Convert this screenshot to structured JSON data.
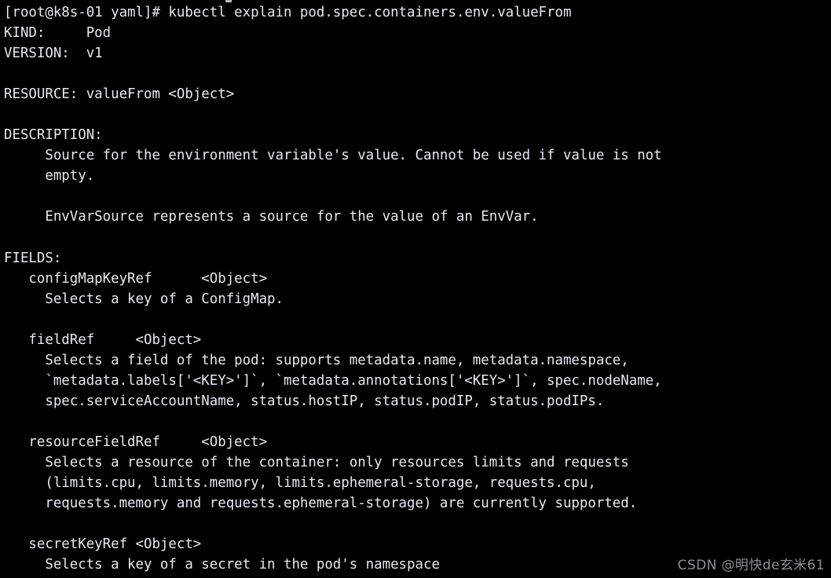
{
  "terminal": {
    "background_color": "#000000",
    "foreground_color": "#e6e9ef",
    "prompt": "[root@k8s-01 yaml]#",
    "command": "kubectl explain pod.spec.containers.env.valueFrom",
    "lines": [
      "[root@k8s-01 yaml]# kubectl explain pod.spec.containers.env.valueFrom",
      "KIND:     Pod",
      "VERSION:  v1",
      "",
      "RESOURCE: valueFrom <Object>",
      "",
      "DESCRIPTION:",
      "     Source for the environment variable's value. Cannot be used if value is not",
      "     empty.",
      "",
      "     EnvVarSource represents a source for the value of an EnvVar.",
      "",
      "FIELDS:",
      "   configMapKeyRef\t<Object>",
      "     Selects a key of a ConfigMap.",
      "",
      "   fieldRef\t<Object>",
      "     Selects a field of the pod: supports metadata.name, metadata.namespace,",
      "     `metadata.labels['<KEY>']`, `metadata.annotations['<KEY>']`, spec.nodeName,",
      "     spec.serviceAccountName, status.hostIP, status.podIP, status.podIPs.",
      "",
      "   resourceFieldRef\t<Object>",
      "     Selects a resource of the container: only resources limits and requests",
      "     (limits.cpu, limits.memory, limits.ephemeral-storage, requests.cpu,",
      "     requests.memory and requests.ephemeral-storage) are currently supported.",
      "",
      "   secretKeyRef <Object>",
      "     Selects a key of a secret in the pod's namespace"
    ],
    "header": {
      "kind_label": "KIND:",
      "kind_value": "Pod",
      "version_label": "VERSION:",
      "version_value": "v1",
      "resource_label": "RESOURCE:",
      "resource_value": "valueFrom <Object>",
      "description_label": "DESCRIPTION:",
      "fields_label": "FIELDS:"
    },
    "description_paragraphs": [
      "Source for the environment variable's value. Cannot be used if value is not empty.",
      "EnvVarSource represents a source for the value of an EnvVar."
    ],
    "fields": [
      {
        "name": "configMapKeyRef",
        "type": "<Object>",
        "description": "Selects a key of a ConfigMap."
      },
      {
        "name": "fieldRef",
        "type": "<Object>",
        "description": "Selects a field of the pod: supports metadata.name, metadata.namespace, `metadata.labels['<KEY>']`, `metadata.annotations['<KEY>']`, spec.nodeName, spec.serviceAccountName, status.hostIP, status.podIP, status.podIPs."
      },
      {
        "name": "resourceFieldRef",
        "type": "<Object>",
        "description": "Selects a resource of the container: only resources limits and requests (limits.cpu, limits.memory, limits.ephemeral-storage, requests.cpu, requests.memory and requests.ephemeral-storage) are currently supported."
      },
      {
        "name": "secretKeyRef",
        "type": "<Object>",
        "description": "Selects a key of a secret in the pod's namespace"
      }
    ]
  },
  "watermark": {
    "text": "CSDN @明快de玄米61",
    "color": "#8c8f94"
  }
}
